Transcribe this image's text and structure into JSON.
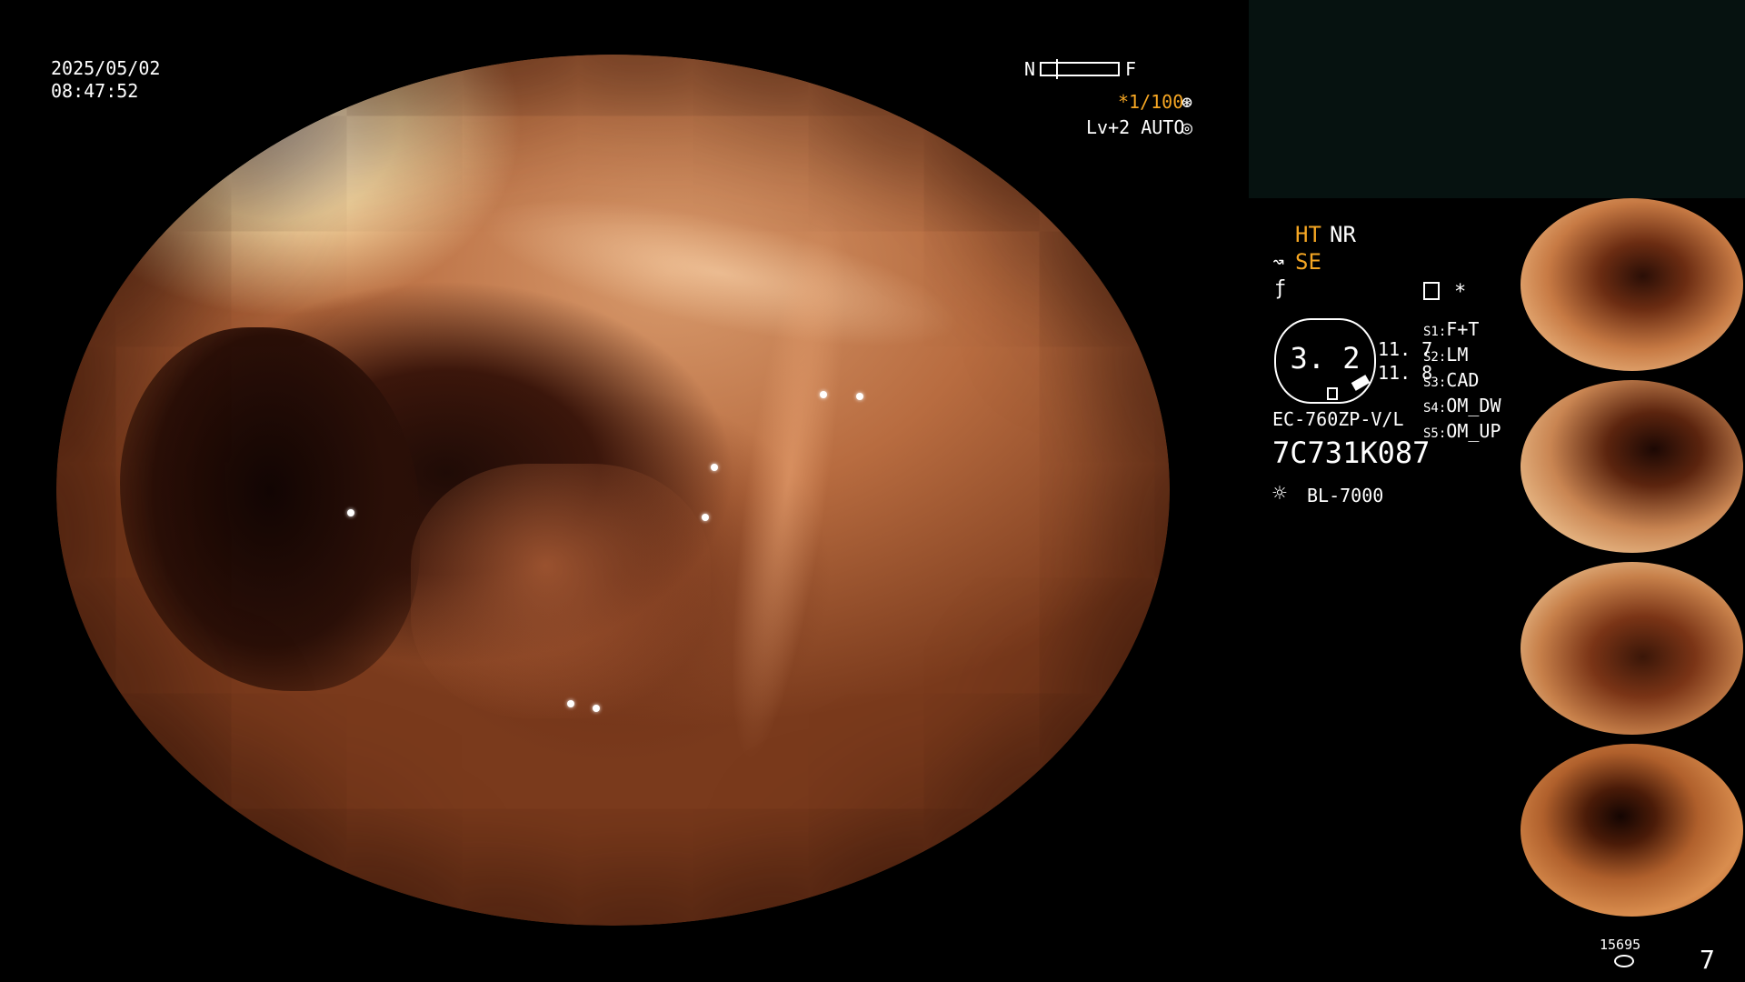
{
  "datetime": {
    "date": "2025/05/02",
    "time": "08:47:52"
  },
  "focus": {
    "near_label": "N",
    "far_label": "F"
  },
  "shutter": {
    "value": "*1/100",
    "icon": "shutter-icon"
  },
  "exposure": {
    "value": "Lv+2 AUTO",
    "icon": "iris-icon"
  },
  "modes": {
    "ht": "HT",
    "nr": "NR",
    "se": "SE",
    "se_icon": "enhance-icon",
    "freeze_icon": "freeze-icon",
    "memo_icon": "memo-icon",
    "asterisk": "*"
  },
  "scope": {
    "zoom": "3. 2",
    "value_a": "11. 7",
    "value_b": "11. 8",
    "model": "EC-760ZP-V/L",
    "serial": "7C731K087"
  },
  "switches": [
    {
      "key": "S1",
      "value": "F+T"
    },
    {
      "key": "S2",
      "value": "LM"
    },
    {
      "key": "S3",
      "value": "CAD"
    },
    {
      "key": "S4",
      "value": "OM_DW"
    },
    {
      "key": "S5",
      "value": "OM_UP"
    }
  ],
  "light_source": {
    "label": "BL-7000",
    "icon": "light-source-icon"
  },
  "counter": {
    "value": "15695",
    "icon": "storage-icon"
  },
  "page_number": "7",
  "colors": {
    "accent": "#f5a623",
    "text": "#ffffff",
    "background": "#000000"
  }
}
